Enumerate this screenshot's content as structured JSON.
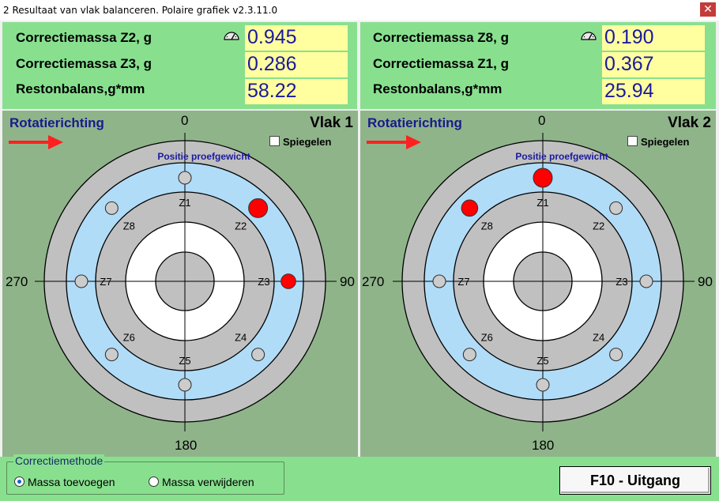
{
  "window": {
    "title": "2 Resultaat van vlak balanceren. Polaire grafiek v2.3.11.0",
    "close_glyph": "✕"
  },
  "plane1": {
    "rows": [
      {
        "label": "Correctiemassa Z2, g",
        "value": "0.945"
      },
      {
        "label": "Correctiemassa Z3, g",
        "value": "0.286"
      },
      {
        "label": "Restonbalans,g*mm",
        "value": "58.22"
      }
    ],
    "rotation_label": "Rotatierichting",
    "plane_label": "Vlak 1",
    "mirror_label": "Spiegelen",
    "trial_label": "Positie proefgewicht",
    "axis": {
      "top": "0",
      "right": "90",
      "bottom": "180",
      "left": "270"
    },
    "zones": [
      "Z1",
      "Z2",
      "Z3",
      "Z4",
      "Z5",
      "Z6",
      "Z7",
      "Z8"
    ],
    "trial_zone": "Z1",
    "corrections": [
      {
        "zone": "Z2",
        "mass": 0.945
      },
      {
        "zone": "Z3",
        "mass": 0.286
      }
    ]
  },
  "plane2": {
    "rows": [
      {
        "label": "Correctiemassa Z8, g",
        "value": "0.190"
      },
      {
        "label": "Correctiemassa Z1, g",
        "value": "0.367"
      },
      {
        "label": "Restonbalans,g*mm",
        "value": "25.94"
      }
    ],
    "rotation_label": "Rotatierichting",
    "plane_label": "Vlak 2",
    "mirror_label": "Spiegelen",
    "trial_label": "Positie proefgewicht",
    "axis": {
      "top": "0",
      "right": "90",
      "bottom": "180",
      "left": "270"
    },
    "zones": [
      "Z1",
      "Z2",
      "Z3",
      "Z4",
      "Z5",
      "Z6",
      "Z7",
      "Z8"
    ],
    "trial_zone": "Z1",
    "corrections": [
      {
        "zone": "Z8",
        "mass": 0.19
      },
      {
        "zone": "Z1",
        "mass": 0.367
      }
    ]
  },
  "method": {
    "legend": "Correctiemethode",
    "option_add": "Massa toevoegen",
    "option_remove": "Massa verwijderen",
    "selected": "add"
  },
  "exit_label": "F10 - Uitgang",
  "colors": {
    "panel": "#88e08f",
    "plot_bg": "#8fb48a",
    "ring_grey": "#c0c0c0",
    "ring_blue": "#b0dcf8",
    "value_bg": "#ffff9f",
    "value_text": "#1a1a9c",
    "correction": "#ff0000",
    "arrow": "#ff2020"
  }
}
